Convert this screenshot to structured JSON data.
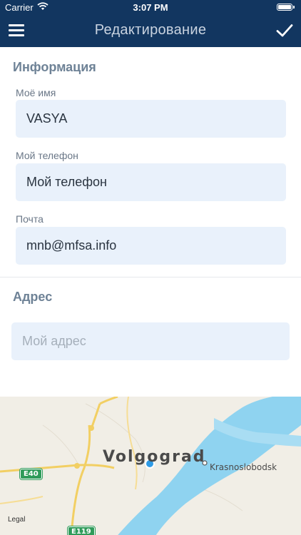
{
  "status_bar": {
    "carrier": "Carrier",
    "time": "3:07 PM"
  },
  "nav": {
    "title": "Редактирование",
    "menu_icon": "hamburger-icon",
    "confirm_icon": "checkmark-icon"
  },
  "info_section": {
    "title": "Информация",
    "fields": [
      {
        "label": "Моё имя",
        "value": "VASYA"
      },
      {
        "label": "Мой телефон",
        "value": "Мой телефон"
      },
      {
        "label": "Почта",
        "value": "mnb@mfsa.info"
      }
    ]
  },
  "address_section": {
    "title": "Адрес",
    "placeholder": "Мой адрес"
  },
  "map": {
    "city": "Volgograd",
    "town": "Krasnoslobodsk",
    "road_e40": "E40",
    "road_e119": "E119",
    "legal": "Legal"
  },
  "colors": {
    "nav_bg": "#123660",
    "field_bg": "#e9f1fb",
    "section_title": "#6e8296",
    "water": "#8fd3f0"
  }
}
